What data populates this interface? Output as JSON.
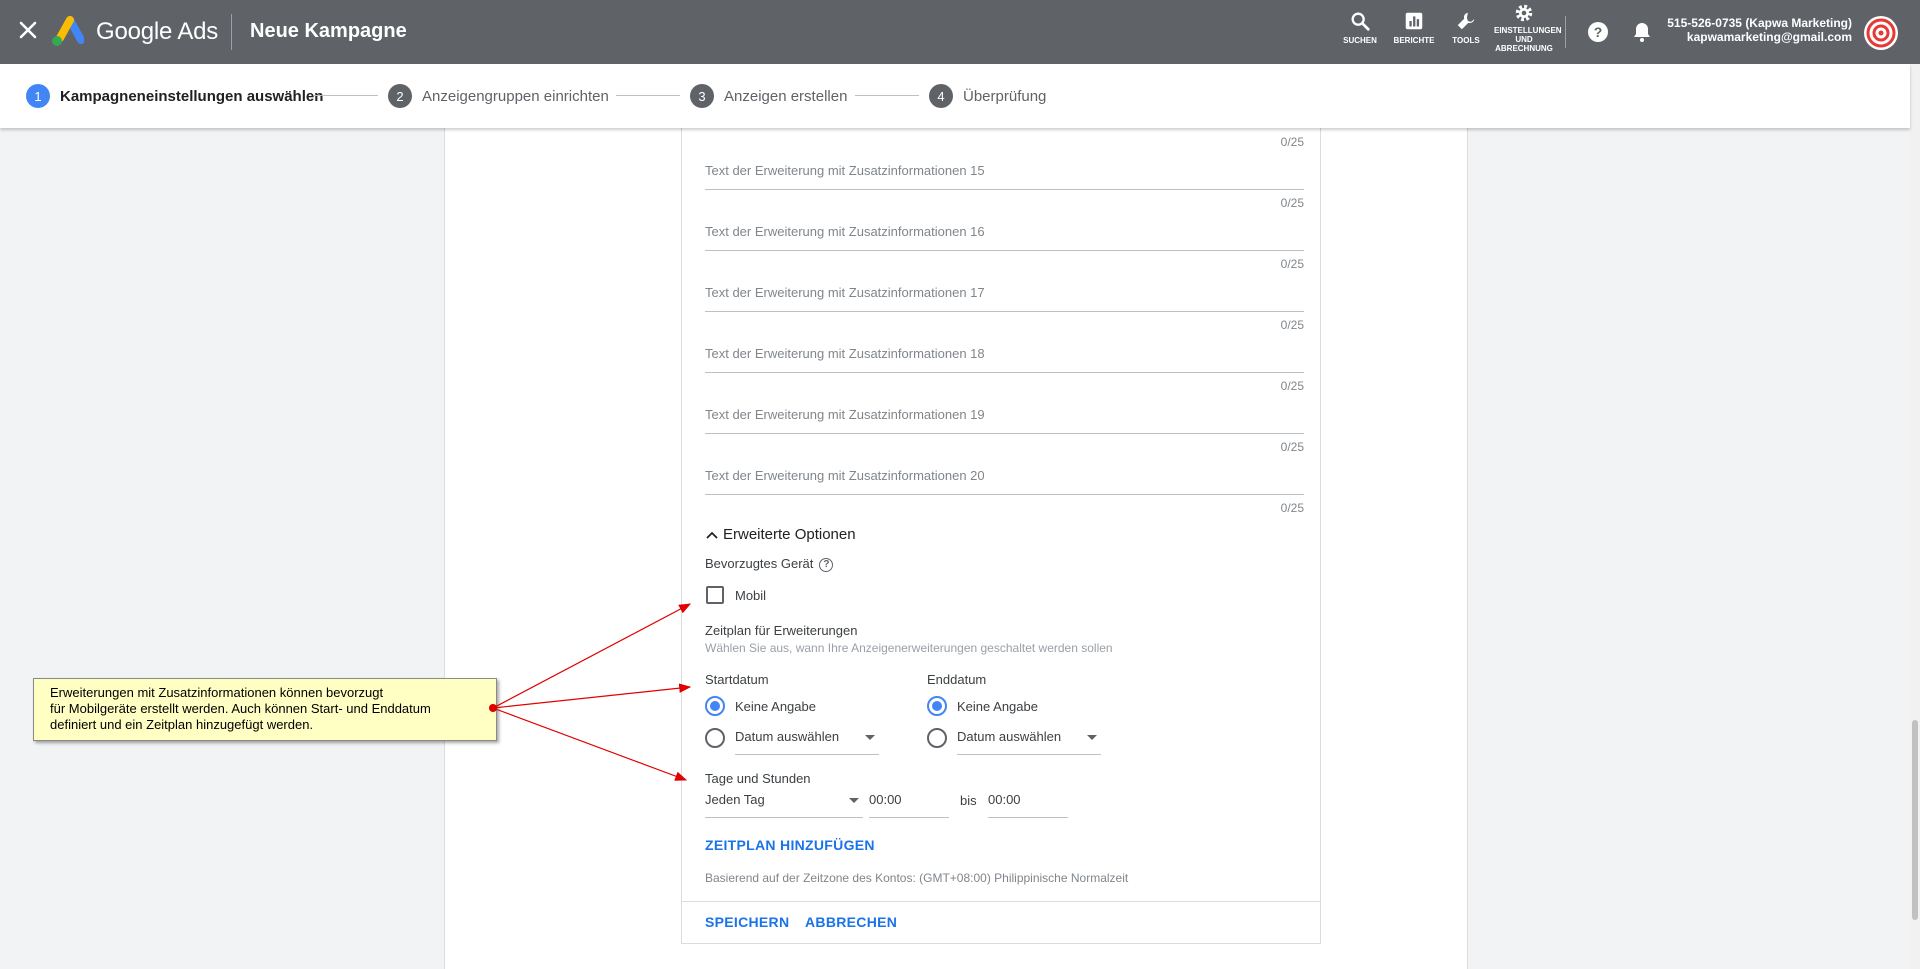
{
  "header": {
    "brand": "Google Ads",
    "title": "Neue Kampagne",
    "tools": [
      {
        "icon": "search-icon",
        "label": "SUCHEN"
      },
      {
        "icon": "reports-icon",
        "label": "BERICHTE"
      },
      {
        "icon": "wrench-icon",
        "label": "TOOLS"
      },
      {
        "icon": "gear-icon",
        "label_lines": [
          "EINSTELLUNGEN",
          "UND",
          "ABRECHNUNG"
        ]
      }
    ],
    "account": {
      "name": "515-526-0735 (Kapwa Marketing)",
      "email": "kapwamarketing@gmail.com"
    }
  },
  "stepper": {
    "steps": [
      {
        "num": "1",
        "label": "Kampagneneinstellungen auswählen",
        "active": true
      },
      {
        "num": "2",
        "label": "Anzeigengruppen einrichten",
        "active": false
      },
      {
        "num": "3",
        "label": "Anzeigen erstellen",
        "active": false
      },
      {
        "num": "4",
        "label": "Überprüfung",
        "active": false
      }
    ]
  },
  "form": {
    "counter": "0/25",
    "fields": [
      {
        "placeholder": "Text der Erweiterung mit Zusatzinformationen 15",
        "counter": "0/25"
      },
      {
        "placeholder": "Text der Erweiterung mit Zusatzinformationen 16",
        "counter": "0/25"
      },
      {
        "placeholder": "Text der Erweiterung mit Zusatzinformationen 17",
        "counter": "0/25"
      },
      {
        "placeholder": "Text der Erweiterung mit Zusatzinformationen 18",
        "counter": "0/25"
      },
      {
        "placeholder": "Text der Erweiterung mit Zusatzinformationen 19",
        "counter": "0/25"
      },
      {
        "placeholder": "Text der Erweiterung mit Zusatzinformationen 20",
        "counter": "0/25"
      }
    ],
    "advanced": {
      "toggle_label": "Erweiterte Optionen",
      "device_label": "Bevorzugtes Gerät",
      "mobile_label": "Mobil",
      "mobile_checked": false,
      "schedule_title": "Zeitplan für Erweiterungen",
      "schedule_hint": "Wählen Sie aus, wann Ihre Anzeigenerweiterungen geschaltet werden sollen",
      "start_label": "Startdatum",
      "end_label": "Enddatum",
      "none_option": "Keine Angabe",
      "date_option": "Datum auswählen",
      "days_hours_label": "Tage und Stunden",
      "day_value": "Jeden Tag",
      "from_time": "00:00",
      "to_word": "bis",
      "to_time": "00:00",
      "add_schedule": "ZEITPLAN HINZUFÜGEN",
      "timezone_note": "Basierend auf der Zeitzone des Kontos: (GMT+08:00) Philippinische Normalzeit"
    },
    "actions": {
      "save": "SPEICHERN",
      "cancel": "ABBRECHEN"
    }
  },
  "callout": {
    "lines": [
      "Erweiterungen mit Zusatzinformationen können bevorzugt",
      "für Mobilgeräte erstellt werden. Auch können Start- und Enddatum",
      "definiert und ein Zeitplan hinzugefügt werden."
    ]
  },
  "colors": {
    "topbar": "#5f6368",
    "accent": "#4285f4",
    "link": "#1a73e8",
    "callout_bg": "#ffffc4",
    "arrow": "#e00000"
  }
}
